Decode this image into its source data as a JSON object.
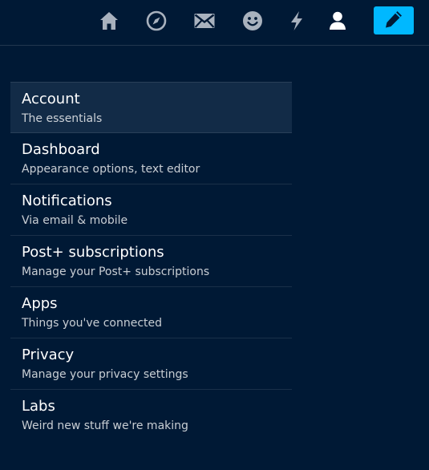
{
  "topbar": {
    "icons": [
      "home-icon",
      "explore-icon",
      "inbox-icon",
      "activity-icon",
      "lightning-icon",
      "account-icon"
    ],
    "compose_icon": "pencil-icon",
    "icon_color": "#a9b2be",
    "active_icon_color": "#ffffff",
    "compose_color": "#00b8ff"
  },
  "settings_menu": {
    "items": [
      {
        "title": "Account",
        "subtitle": "The essentials",
        "active": true
      },
      {
        "title": "Dashboard",
        "subtitle": "Appearance options, text editor",
        "active": false
      },
      {
        "title": "Notifications",
        "subtitle": "Via email & mobile",
        "active": false
      },
      {
        "title": "Post+ subscriptions",
        "subtitle": "Manage your Post+ subscriptions",
        "active": false
      },
      {
        "title": "Apps",
        "subtitle": "Things you've connected",
        "active": false
      },
      {
        "title": "Privacy",
        "subtitle": "Manage your privacy settings",
        "active": false
      },
      {
        "title": "Labs",
        "subtitle": "Weird new stuff we're making",
        "active": false
      }
    ]
  },
  "colors": {
    "background": "#001935",
    "active_row": "#122b47"
  }
}
